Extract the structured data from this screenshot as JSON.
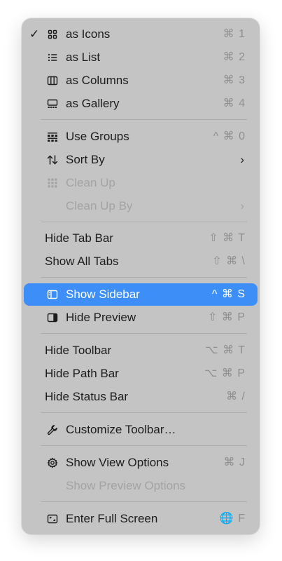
{
  "menu": {
    "check_mark": "✓",
    "items": [
      {
        "label": "as Icons",
        "shortcut": "⌘ 1",
        "icon": "grid-icon"
      },
      {
        "label": "as List",
        "shortcut": "⌘ 2",
        "icon": "list-icon"
      },
      {
        "label": "as Columns",
        "shortcut": "⌘ 3",
        "icon": "columns-icon"
      },
      {
        "label": "as Gallery",
        "shortcut": "⌘ 4",
        "icon": "gallery-icon"
      },
      {
        "label": "Use Groups",
        "shortcut": "^ ⌘ 0",
        "icon": "groups-icon"
      },
      {
        "label": "Sort By",
        "submenu_arrow": "›",
        "icon": "sort-icon"
      },
      {
        "label": "Clean Up",
        "icon": "cleanup-grid-icon"
      },
      {
        "label": "Clean Up By",
        "submenu_arrow": "›"
      },
      {
        "label": "Hide Tab Bar",
        "shortcut": "⇧ ⌘ T"
      },
      {
        "label": "Show All Tabs",
        "shortcut": "⇧ ⌘ \\"
      },
      {
        "label": "Show Sidebar",
        "shortcut": "^ ⌘ S",
        "icon": "sidebar-icon"
      },
      {
        "label": "Hide Preview",
        "shortcut": "⇧ ⌘ P",
        "icon": "preview-pane-icon"
      },
      {
        "label": "Hide Toolbar",
        "shortcut": "⌥ ⌘ T"
      },
      {
        "label": "Hide Path Bar",
        "shortcut": "⌥ ⌘ P"
      },
      {
        "label": "Hide Status Bar",
        "shortcut": "⌘ /"
      },
      {
        "label": "Customize Toolbar…",
        "icon": "wrench-icon"
      },
      {
        "label": "Show View Options",
        "shortcut": "⌘ J",
        "icon": "gear-icon"
      },
      {
        "label": "Show Preview Options"
      },
      {
        "label": "Enter Full Screen",
        "shortcut": "🌐 F",
        "icon": "fullscreen-icon"
      }
    ]
  },
  "colors": {
    "menu_background": "#c4c4c4",
    "highlight": "#3d8ff7",
    "text": "#1c1c1c",
    "disabled_text": "#a3a3a3",
    "shortcut_text": "#8f8f8f"
  }
}
